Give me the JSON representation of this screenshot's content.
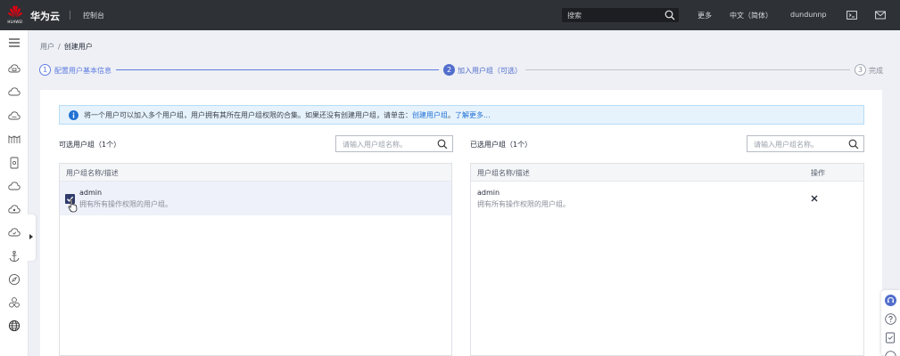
{
  "header": {
    "logo_text": "HUAWEI",
    "brand": "华为云",
    "console": "控制台",
    "search_placeholder": "搜索",
    "more": "更多",
    "language": "中文（简体）",
    "username": "dundunnp",
    "icons": [
      "search-icon",
      "terminal-icon",
      "mail-icon"
    ]
  },
  "sidebar": {
    "icons": [
      "menu-icon",
      "cloud-server-icon",
      "cloud-icon",
      "cloud-storage-icon",
      "bridge-icon",
      "container-icon",
      "cloud-network-icon",
      "cloud-database-icon",
      "cloud-security-icon",
      "anchor-icon",
      "compass-icon",
      "cluster-icon",
      "globe-icon"
    ]
  },
  "breadcrumb": {
    "parent": "用户",
    "separator": "/",
    "current": "创建用户"
  },
  "steps": [
    {
      "number": "1",
      "label": "配置用户基本信息",
      "state": "done"
    },
    {
      "number": "2",
      "label": "加入用户组（可选）",
      "state": "active"
    },
    {
      "number": "3",
      "label": "完成",
      "state": "pending"
    }
  ],
  "info": {
    "text": "将一个用户可以加入多个用户组，用户拥有其所在用户组权限的合集。如果还没有创建用户组，请单击：",
    "link_create": "创建用户组",
    "separator": "。",
    "link_more": "了解更多..."
  },
  "available": {
    "title": "可选用户组（1个）",
    "search_placeholder": "请输入用户组名称。",
    "column_header": "用户组名称/描述",
    "rows": [
      {
        "name": "admin",
        "description": "拥有所有操作权限的用户组。",
        "checked": true
      }
    ]
  },
  "selected": {
    "title": "已选用户组（1个）",
    "search_placeholder": "请输入用户组名称。",
    "column_header": "用户组名称/描述",
    "action_header": "操作",
    "rows": [
      {
        "name": "admin",
        "description": "拥有所有操作权限的用户组。"
      }
    ]
  },
  "floating_tools": [
    "customer-service-icon",
    "help-icon",
    "feedback-icon",
    "more-icon"
  ],
  "colors": {
    "topbar": "#2e3135",
    "accent": "#5e7ce0",
    "step_active": "#526ecc",
    "info_bg": "#e6f3fc",
    "link": "#2271d4",
    "checkbox": "#2f3b6b"
  }
}
